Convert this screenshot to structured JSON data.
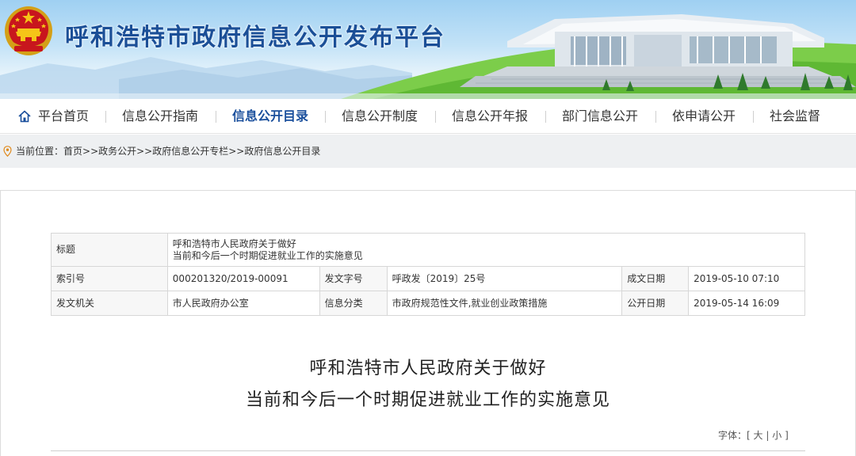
{
  "site": {
    "title": "呼和浩特市政府信息公开发布平台"
  },
  "nav": {
    "items": [
      {
        "label": "平台首页",
        "active": false
      },
      {
        "label": "信息公开指南",
        "active": false
      },
      {
        "label": "信息公开目录",
        "active": true
      },
      {
        "label": "信息公开制度",
        "active": false
      },
      {
        "label": "信息公开年报",
        "active": false
      },
      {
        "label": "部门信息公开",
        "active": false
      },
      {
        "label": "依申请公开",
        "active": false
      },
      {
        "label": "社会监督",
        "active": false
      }
    ]
  },
  "breadcrumb": {
    "label": "当前位置：",
    "path": "首页>>政务公开>>政府信息公开专栏>>政府信息公开目录"
  },
  "meta": {
    "title_label": "标题",
    "title_line1": "呼和浩特市人民政府关于做好",
    "title_line2": "当前和今后一个时期促进就业工作的实施意见",
    "index_label": "索引号",
    "index_value": "000201320/2019-00091",
    "docno_label": "发文字号",
    "docno_value": "呼政发〔2019〕25号",
    "created_label": "成文日期",
    "created_value": "2019-05-10 07:10",
    "issuer_label": "发文机关",
    "issuer_value": "市人民政府办公室",
    "category_label": "信息分类",
    "category_value": "市政府规范性文件,就业创业政策措施",
    "published_label": "公开日期",
    "published_value": "2019-05-14 16:09"
  },
  "document": {
    "title_line1": "呼和浩特市人民政府关于做好",
    "title_line2": "当前和今后一个时期促进就业工作的实施意见"
  },
  "font_control": {
    "label": "字体：[",
    "large": "大",
    "sep": "|",
    "small": "小",
    "close": "]"
  },
  "colors": {
    "title_blue": "#1b4f97",
    "nav_active": "#1a4f9c",
    "crumb_bg": "#eef0f2"
  },
  "icons": {
    "home": "home-icon",
    "location": "location-pin-icon",
    "emblem": "national-emblem"
  }
}
